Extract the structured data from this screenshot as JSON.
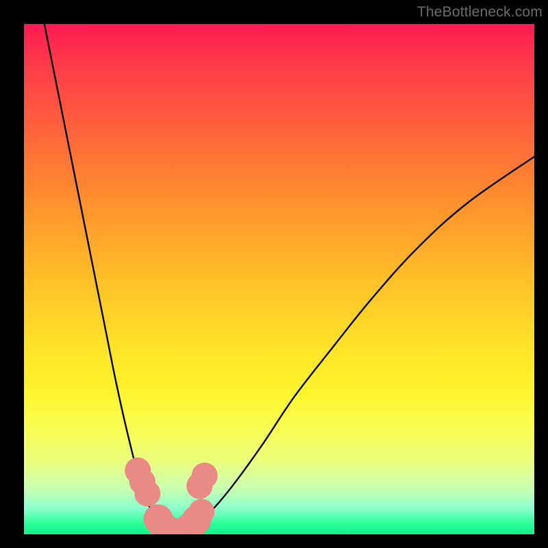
{
  "watermark": "TheBottleneck.com",
  "chart_data": {
    "type": "line",
    "title": "",
    "xlabel": "",
    "ylabel": "",
    "xlim": [
      0,
      100
    ],
    "ylim": [
      0,
      100
    ],
    "background_gradient_stops": [
      {
        "pos": 0,
        "color": "#ff1a53"
      },
      {
        "pos": 18,
        "color": "#ff5a3f"
      },
      {
        "pos": 38,
        "color": "#ff9a2c"
      },
      {
        "pos": 62,
        "color": "#ffe028"
      },
      {
        "pos": 80,
        "color": "#f8ff56"
      },
      {
        "pos": 95,
        "color": "#8affce"
      },
      {
        "pos": 100,
        "color": "#12f08a"
      }
    ],
    "series": [
      {
        "name": "left-branch",
        "color": "#000000",
        "x": [
          4,
          6,
          8,
          10,
          12,
          14,
          16,
          18,
          20,
          22,
          23.5,
          25,
          26,
          27
        ],
        "y": [
          100,
          90,
          80,
          70,
          60,
          50,
          40,
          30,
          21,
          13,
          8,
          4.5,
          2.5,
          1.5
        ]
      },
      {
        "name": "right-branch",
        "color": "#000000",
        "x": [
          33,
          35,
          38,
          42,
          47,
          53,
          60,
          68,
          77,
          87,
          100
        ],
        "y": [
          1.5,
          3,
          6,
          11,
          18,
          27,
          36,
          46,
          56,
          65,
          74
        ]
      },
      {
        "name": "valley-floor",
        "color": "#000000",
        "x": [
          27,
          28,
          30,
          32,
          33
        ],
        "y": [
          1.5,
          0.5,
          0,
          0.5,
          1.5
        ]
      }
    ],
    "markers": [
      {
        "name": "left-dot-1",
        "x": 22.3,
        "y": 12.5,
        "r": 1.6,
        "color": "#e98a86"
      },
      {
        "name": "left-dot-2",
        "x": 23.2,
        "y": 10.3,
        "r": 1.6,
        "color": "#e98a86"
      },
      {
        "name": "left-dot-3",
        "x": 24.2,
        "y": 8.0,
        "r": 1.6,
        "color": "#e98a86"
      },
      {
        "name": "left-dot-4",
        "x": 26.3,
        "y": 3.0,
        "r": 1.8,
        "color": "#e98a86"
      },
      {
        "name": "left-dot-5",
        "x": 27.5,
        "y": 1.3,
        "r": 1.8,
        "color": "#e98a86"
      },
      {
        "name": "floor-dot-1",
        "x": 29.0,
        "y": 0.4,
        "r": 1.8,
        "color": "#e98a86"
      },
      {
        "name": "floor-dot-2",
        "x": 31.0,
        "y": 0.4,
        "r": 1.8,
        "color": "#e98a86"
      },
      {
        "name": "right-dot-1",
        "x": 32.5,
        "y": 1.3,
        "r": 1.8,
        "color": "#e98a86"
      },
      {
        "name": "right-dot-2",
        "x": 33.8,
        "y": 2.8,
        "r": 1.8,
        "color": "#e98a86"
      },
      {
        "name": "right-dot-3",
        "x": 34.8,
        "y": 4.4,
        "r": 1.6,
        "color": "#e98a86"
      },
      {
        "name": "right-dot-4",
        "x": 34.4,
        "y": 9.5,
        "r": 1.6,
        "color": "#e98a86"
      },
      {
        "name": "right-dot-5",
        "x": 35.4,
        "y": 11.5,
        "r": 1.6,
        "color": "#e98a86"
      }
    ]
  }
}
